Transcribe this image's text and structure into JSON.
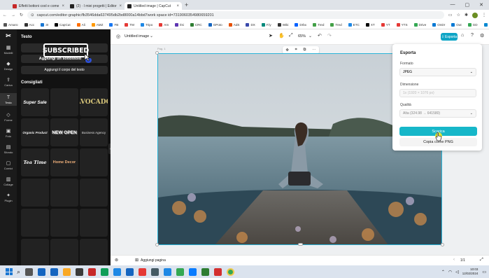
{
  "browser": {
    "tabs": [
      {
        "title": "Effetti bottoni cool e come u",
        "active": false,
        "color": "#c62828"
      },
      {
        "title": "(2) · I miei progetti | Editor onl",
        "active": false,
        "color": "#222"
      },
      {
        "title": "Untitled image | CapCut",
        "active": true,
        "color": "#222"
      }
    ],
    "url": "capcut.com/editor-graphic/fb3546dda637495db2bd8000a14bbd7work space id=7319060354980659201",
    "bookmarks": [
      "Amaro",
      "Acc",
      "3I",
      "CapCut",
      "Ali",
      "AMZ",
      "FB",
      "TM",
      "Tripo",
      "Am",
      "Ilsi",
      "CRC",
      "GPoto",
      "AdS",
      "DX",
      "F.ly",
      "Wiki",
      "Drbx",
      "Tred",
      "Tred",
      "ETC",
      "XT",
      "YT",
      "YTS",
      "Drive",
      "OnDr",
      "Out",
      "GD",
      "RRM",
      "Sfruttare"
    ]
  },
  "rail": [
    {
      "label": "Modelli",
      "icon": "▦"
    },
    {
      "label": "Design",
      "icon": "◆"
    },
    {
      "label": "Carica",
      "icon": "⇪"
    },
    {
      "label": "Testo",
      "icon": "T"
    },
    {
      "label": "Forme",
      "icon": "◇"
    },
    {
      "label": "Foto",
      "icon": "▣"
    },
    {
      "label": "Sfondo",
      "icon": "▤"
    },
    {
      "label": "Cornici",
      "icon": "▢"
    },
    {
      "label": "Collage",
      "icon": "▥"
    },
    {
      "label": "Plugin",
      "icon": "✦"
    }
  ],
  "panel": {
    "title": "Testo",
    "subscribed": "SUBSCRIBED",
    "add_subtitle": "Aggiungi un sottotitolo",
    "add_body": "Aggiungi il corpo del testo",
    "suggested": "Consigliati",
    "samples": [
      "Super Sale",
      "",
      "AVOCADO",
      "Organic Product",
      "NEW OPEN",
      "Business Agency",
      "Tea Time",
      "Home Decor"
    ]
  },
  "editor": {
    "title": "Untitled image",
    "zoom": "65%",
    "export_btn": "Esporta",
    "page_label": "Pag. 1",
    "add_pages": "Aggiungi pagina",
    "pager": "1/1"
  },
  "export": {
    "header": "Esporta",
    "format_label": "Formato",
    "format": "JPEG",
    "dimension_label": "Dimensione",
    "dimension": "1x (1920 × 1076 px)",
    "quality_label": "Qualità",
    "quality": "Alta (324.98 → 641580)",
    "download": "Scarica",
    "copy": "Copia come PNG"
  },
  "taskbar": {
    "time": "10:03",
    "date": "12/02/2024"
  }
}
